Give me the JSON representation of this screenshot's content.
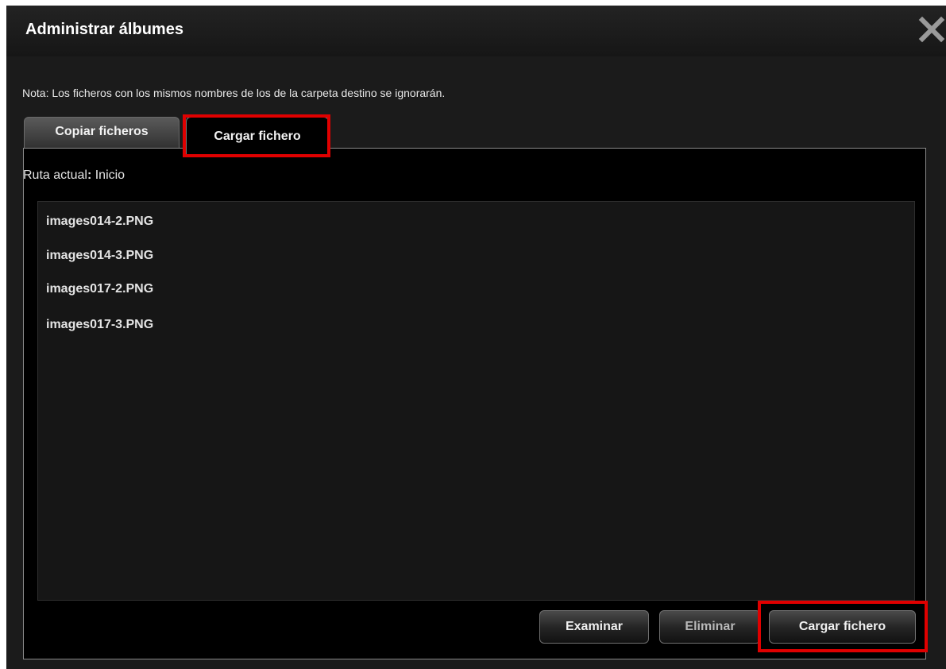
{
  "dialog": {
    "title": "Administrar álbumes",
    "close_icon": "close-icon"
  },
  "note": "Nota: Los ficheros con los mismos nombres de los de la carpeta destino se ignorarán.",
  "tabs": [
    {
      "label": "Copiar ficheros",
      "active": false
    },
    {
      "label": "Cargar fichero",
      "active": true
    }
  ],
  "path": {
    "label": "Ruta actual",
    "colon": ":",
    "value": "Inicio"
  },
  "files": [
    "images014-2.PNG",
    "images014-3.PNG",
    "images017-2.PNG",
    "images017-3.PNG"
  ],
  "buttons": {
    "browse": "Examinar",
    "delete": "Eliminar",
    "upload": "Cargar fichero"
  },
  "colors": {
    "background": "#1b1b1b",
    "panel": "#000000",
    "highlight": "#e00000"
  }
}
